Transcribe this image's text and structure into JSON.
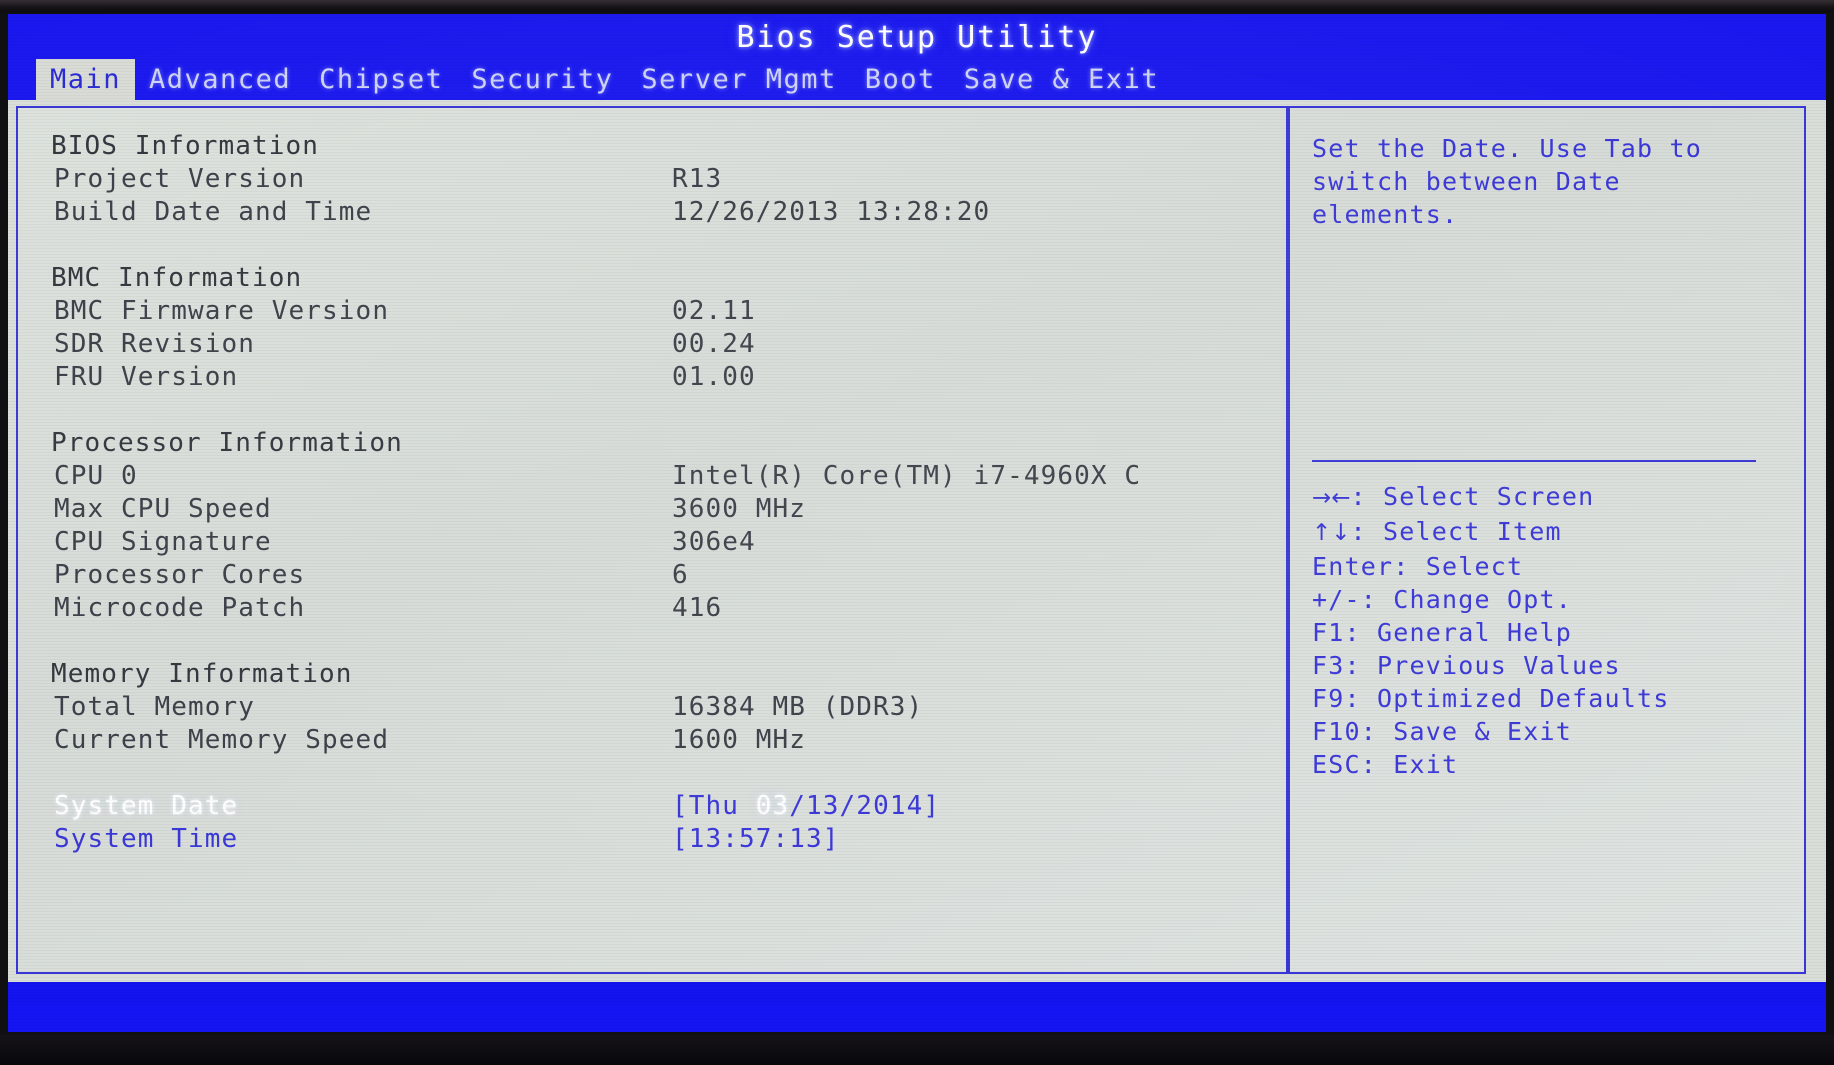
{
  "window": {
    "title": "Bios Setup Utility"
  },
  "menubar": {
    "tabs": [
      {
        "label": "Main",
        "active": true
      },
      {
        "label": "Advanced",
        "active": false
      },
      {
        "label": "Chipset",
        "active": false
      },
      {
        "label": "Security",
        "active": false
      },
      {
        "label": "Server Mgmt",
        "active": false
      },
      {
        "label": "Boot",
        "active": false
      },
      {
        "label": "Save & Exit",
        "active": false
      }
    ]
  },
  "main": {
    "rows": [
      {
        "type": "section",
        "label": "BIOS Information",
        "value": ""
      },
      {
        "type": "info",
        "label": "Project Version",
        "value": "R13"
      },
      {
        "type": "info",
        "label": "Build Date and Time",
        "value": "12/26/2013 13:28:20"
      },
      {
        "type": "spacer",
        "label": "",
        "value": ""
      },
      {
        "type": "section",
        "label": "BMC Information",
        "value": ""
      },
      {
        "type": "info",
        "label": "BMC Firmware Version",
        "value": "02.11"
      },
      {
        "type": "info",
        "label": "SDR Revision",
        "value": "00.24"
      },
      {
        "type": "info",
        "label": "FRU Version",
        "value": "01.00"
      },
      {
        "type": "spacer",
        "label": "",
        "value": ""
      },
      {
        "type": "section",
        "label": "Processor Information",
        "value": ""
      },
      {
        "type": "info",
        "label": "CPU 0",
        "value": "Intel(R) Core(TM) i7-4960X C"
      },
      {
        "type": "info",
        "label": "Max CPU Speed",
        "value": "3600 MHz"
      },
      {
        "type": "info",
        "label": "CPU Signature",
        "value": "306e4"
      },
      {
        "type": "info",
        "label": "Processor Cores",
        "value": "6"
      },
      {
        "type": "info",
        "label": "Microcode Patch",
        "value": "416"
      },
      {
        "type": "spacer",
        "label": "",
        "value": ""
      },
      {
        "type": "section",
        "label": "Memory Information",
        "value": ""
      },
      {
        "type": "info",
        "label": "Total Memory",
        "value": "16384 MB (DDR3)"
      },
      {
        "type": "info",
        "label": "Current Memory Speed",
        "value": "1600 MHz"
      },
      {
        "type": "spacer",
        "label": "",
        "value": ""
      },
      {
        "type": "selected",
        "label": "System Date",
        "value_prefix": "[Thu ",
        "value_active": "03",
        "value_suffix": "/13/2014]"
      },
      {
        "type": "editable",
        "label": "System Time",
        "value": "[13:57:13]"
      }
    ]
  },
  "help": {
    "text_lines": [
      "Set the Date. Use Tab to",
      "switch between Date",
      "elements."
    ],
    "keys": [
      {
        "glyph": "→←",
        "text": ": Select Screen"
      },
      {
        "glyph": "↑↓",
        "text": ": Select Item"
      },
      {
        "glyph": "",
        "text": "Enter: Select"
      },
      {
        "glyph": "",
        "text": "+/-: Change Opt."
      },
      {
        "glyph": "",
        "text": "F1: General Help"
      },
      {
        "glyph": "",
        "text": "F3: Previous Values"
      },
      {
        "glyph": "",
        "text": "F9: Optimized Defaults"
      },
      {
        "glyph": "",
        "text": "F10: Save & Exit"
      },
      {
        "glyph": "",
        "text": "ESC: Exit"
      }
    ]
  },
  "colors": {
    "screen_blue": "#1414f0",
    "panel_bg": "#d9ded9",
    "accent_blue": "#3a37d8",
    "text_dark": "#3b3f47",
    "selected_white": "#ffffff"
  }
}
